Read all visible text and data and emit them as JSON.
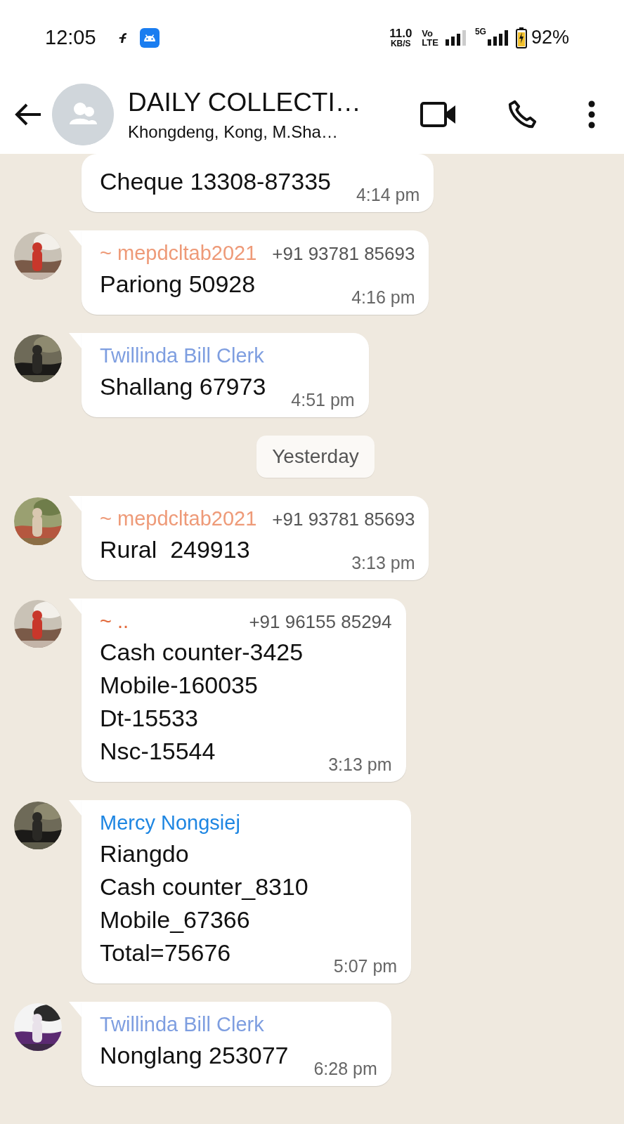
{
  "status_bar": {
    "time": "12:05",
    "speed": "11.0",
    "speed_unit": "KB/S",
    "volte": "Vo",
    "volte_sub": "LTE",
    "network": "5G",
    "battery": "92%"
  },
  "header": {
    "title": "DAILY COLLECTI…",
    "subtitle": "Khongdeng, Kong, M.Sha…"
  },
  "messages": [
    {
      "kind": "message",
      "text": "Cheque 13308-87335",
      "time": "4:14 pm"
    },
    {
      "kind": "message",
      "sender": "~ mepdcltab2021",
      "color": "#ee9a78",
      "phone": "+91 93781 85693",
      "text": "Pariong 50928",
      "time": "4:16 pm"
    },
    {
      "kind": "message",
      "sender": "Twillinda Bill Clerk",
      "color": "#7e9ee0",
      "text": "Shallang 67973",
      "time": "4:51 pm"
    },
    {
      "kind": "date",
      "text": "Yesterday"
    },
    {
      "kind": "message",
      "sender": "~ mepdcltab2021",
      "color": "#ee9a78",
      "phone": "+91 93781 85693",
      "text": "Rural  249913",
      "time": "3:13 pm"
    },
    {
      "kind": "message",
      "sender": "~ ..",
      "color": "#e26a3c",
      "phone": "+91 96155 85294",
      "text": "Cash counter-3425\nMobile-160035\nDt-15533\nNsc-15544",
      "time": "3:13 pm"
    },
    {
      "kind": "message",
      "sender": "Mercy Nongsiej",
      "color": "#1e86e2",
      "text": "Riangdo\nCash counter_8310\nMobile_67366\nTotal=75676",
      "time": "5:07 pm"
    },
    {
      "kind": "message",
      "sender": "Twillinda Bill Clerk",
      "color": "#7e9ee0",
      "text": "Nonglang 253077",
      "time": "6:28 pm"
    }
  ]
}
